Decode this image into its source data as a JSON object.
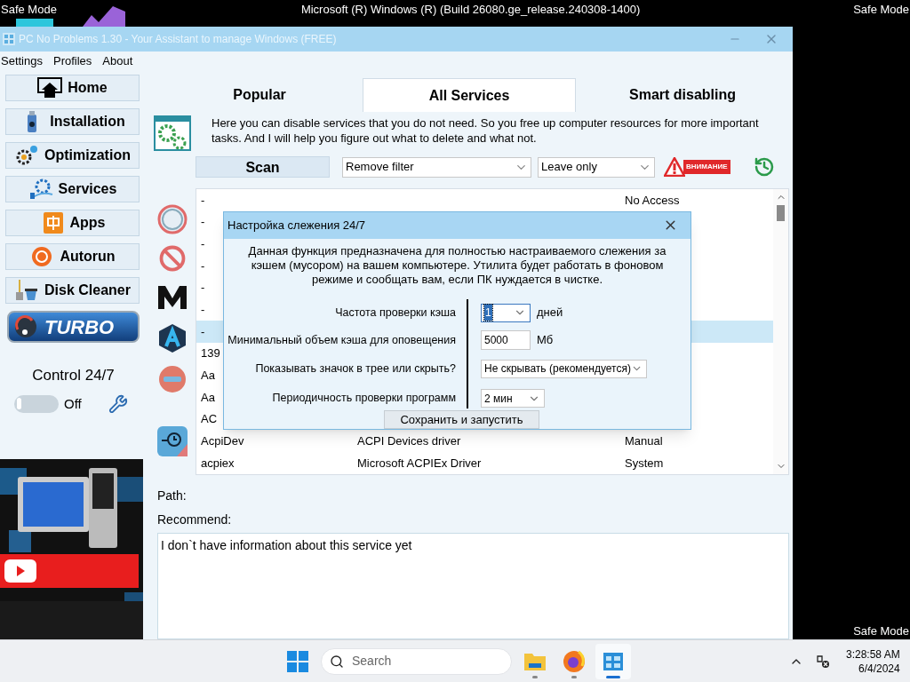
{
  "desktop": {
    "top_left": "Safe Mode",
    "top_center": "Microsoft (R) Windows (R) (Build 26080.ge_release.240308-1400)",
    "top_right": "Safe Mode",
    "bottom_right": "Safe Mode"
  },
  "window": {
    "title": "PC No Problems 1.30 - Your Assistant to manage Windows (FREE)"
  },
  "menu": [
    "Settings",
    "Profiles",
    "About"
  ],
  "nav": [
    "Home",
    "Installation",
    "Optimization",
    "Services",
    "Apps",
    "Autorun",
    "Disk Cleaner"
  ],
  "turbo": "TURBO",
  "control": {
    "title": "Control 24/7",
    "on": false,
    "state_label": "Off"
  },
  "promo": {
    "kind": "picture"
  },
  "tabs": [
    {
      "label": "Popular",
      "selected": false
    },
    {
      "label": "All Services",
      "selected": true
    },
    {
      "label": "Smart disabling",
      "selected": false
    }
  ],
  "description": "Here you can disable services that you do not need. So you free up computer resources for more important tasks. And I will help you figure out what to delete and what not.",
  "toolbar": {
    "scan": "Scan",
    "filter": "Remove filter",
    "leave": "Leave only",
    "warning": "ВНИМАНИЕ"
  },
  "table": {
    "rows": [
      {
        "column_1": "-",
        "column_3": "No Access",
        "selected": false
      },
      {
        "column_1": "-",
        "selected": false
      },
      {
        "column_1": "-",
        "selected": false
      },
      {
        "column_1": "-",
        "selected": false
      },
      {
        "column_1": "-",
        "selected": false
      },
      {
        "column_1": "-",
        "selected": false
      },
      {
        "column_1": "-",
        "selected": true
      },
      {
        "column_1": "139",
        "selected": false
      },
      {
        "column_1": "Aa",
        "selected": false
      },
      {
        "column_1": "Aa",
        "selected": false
      },
      {
        "column_1": "AC",
        "selected": false
      },
      {
        "column_1": "AcpiDev",
        "column_2": "ACPI Devices driver",
        "column_3": "Manual",
        "selected": false
      },
      {
        "column_1": "acpiex",
        "column_2": "Microsoft ACPIEx Driver",
        "column_3": "System",
        "selected": false
      }
    ]
  },
  "details": {
    "path_label": "Path:",
    "recommend_label": "Recommend:",
    "text": "I don`t have information about this service yet"
  },
  "dialog": {
    "title": "Настройка слежения 24/7",
    "description": "Данная функция предназначена для полностью настраиваемого слежения за кэшем (мусором) на вашем компьютере. Утилита будет работать в фоновом режиме и сообщать вам, если ПК нуждается в чистке.",
    "fields": [
      {
        "kind": "select",
        "label": "Частота проверки кэша",
        "value": "1",
        "unit": "дней",
        "focused": true
      },
      {
        "kind": "input",
        "label": "Минимальный объем кэша для оповещения",
        "value": "5000",
        "unit": "Мб",
        "focused": false
      },
      {
        "kind": "select",
        "label": "Показывать значок в трее или скрыть?",
        "value": "Не скрывать (рекомендуется)",
        "focused": false
      },
      {
        "kind": "select",
        "label": "Периодичность проверки программ",
        "value": "2 мин",
        "focused": false
      }
    ],
    "button": "Сохранить и запустить"
  },
  "taskbar": {
    "search_placeholder": "Search",
    "apps": [
      {
        "selected": false
      },
      {
        "selected": false
      },
      {
        "selected": true
      }
    ],
    "time": "3:28:58 AM",
    "date": "6/4/2024"
  }
}
